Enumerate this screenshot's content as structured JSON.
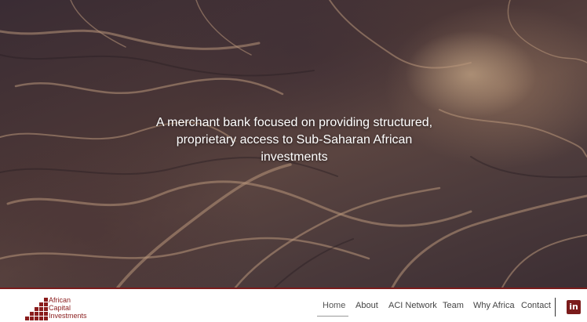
{
  "hero": {
    "tagline_line1": "A merchant bank focused on providing structured,",
    "tagline_line2": "proprietary access to Sub-Saharan African",
    "tagline_line3": "investments"
  },
  "logo": {
    "line1": "African",
    "line2": "Capital",
    "line3": "Investments"
  },
  "nav": {
    "items": [
      {
        "label": "Home",
        "active": true
      },
      {
        "label": "About"
      },
      {
        "label": "ACI Network"
      },
      {
        "label": "Team"
      },
      {
        "label": "Why Africa"
      },
      {
        "label": "Contact"
      }
    ]
  },
  "social": {
    "icon": "linkedin-icon",
    "label": "in"
  },
  "colors": {
    "brand": "#7b1b1b",
    "nav_text": "#444444"
  }
}
